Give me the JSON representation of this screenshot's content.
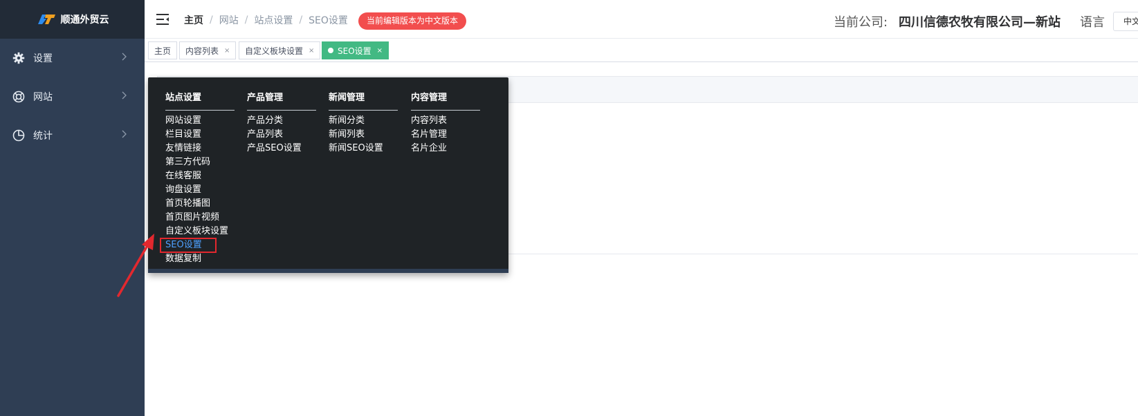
{
  "brand": {
    "name": "顺通外贸云"
  },
  "sidebar": {
    "items": [
      {
        "label": "设置",
        "icon": "gear-icon"
      },
      {
        "label": "网站",
        "icon": "lifebuoy-icon"
      },
      {
        "label": "统计",
        "icon": "pie-chart-icon"
      }
    ]
  },
  "header": {
    "breadcrumb": [
      "主页",
      "网站",
      "站点设置",
      "SEO设置"
    ],
    "version_badge": "当前编辑版本为中文版本",
    "company_label": "当前公司:",
    "company_name": "四川信德农牧有限公司—新站",
    "language_label": "语言",
    "language_value": "中文"
  },
  "tabs": [
    {
      "label": "主页",
      "closable": false,
      "active": false
    },
    {
      "label": "内容列表",
      "closable": true,
      "active": false
    },
    {
      "label": "自定义板块设置",
      "closable": true,
      "active": false
    },
    {
      "label": "SEO设置",
      "closable": true,
      "active": true
    }
  ],
  "tab_close_glyph": "×",
  "mega_menu": {
    "columns": [
      {
        "title": "站点设置",
        "items": [
          "网站设置",
          "栏目设置",
          "友情链接",
          "第三方代码",
          "在线客服",
          "询盘设置",
          "首页轮播图",
          "首页图片视频",
          "自定义板块设置",
          "SEO设置",
          "数据复制"
        ]
      },
      {
        "title": "产品管理",
        "items": [
          "产品分类",
          "产品列表",
          "产品SEO设置"
        ]
      },
      {
        "title": "新闻管理",
        "items": [
          "新闻分类",
          "新闻列表",
          "新闻SEO设置"
        ]
      },
      {
        "title": "内容管理",
        "items": [
          "内容列表",
          "名片管理",
          "名片企业"
        ]
      }
    ],
    "highlighted_item": "SEO设置"
  },
  "colors": {
    "sidebar_bg": "#2f3e54",
    "brand_bg": "#222b37",
    "active_tab": "#42b983",
    "badge": "#f24e4e",
    "menu_bg": "#1f2326",
    "annotation_red": "#e3282e",
    "link_blue": "#4ea0ff"
  }
}
